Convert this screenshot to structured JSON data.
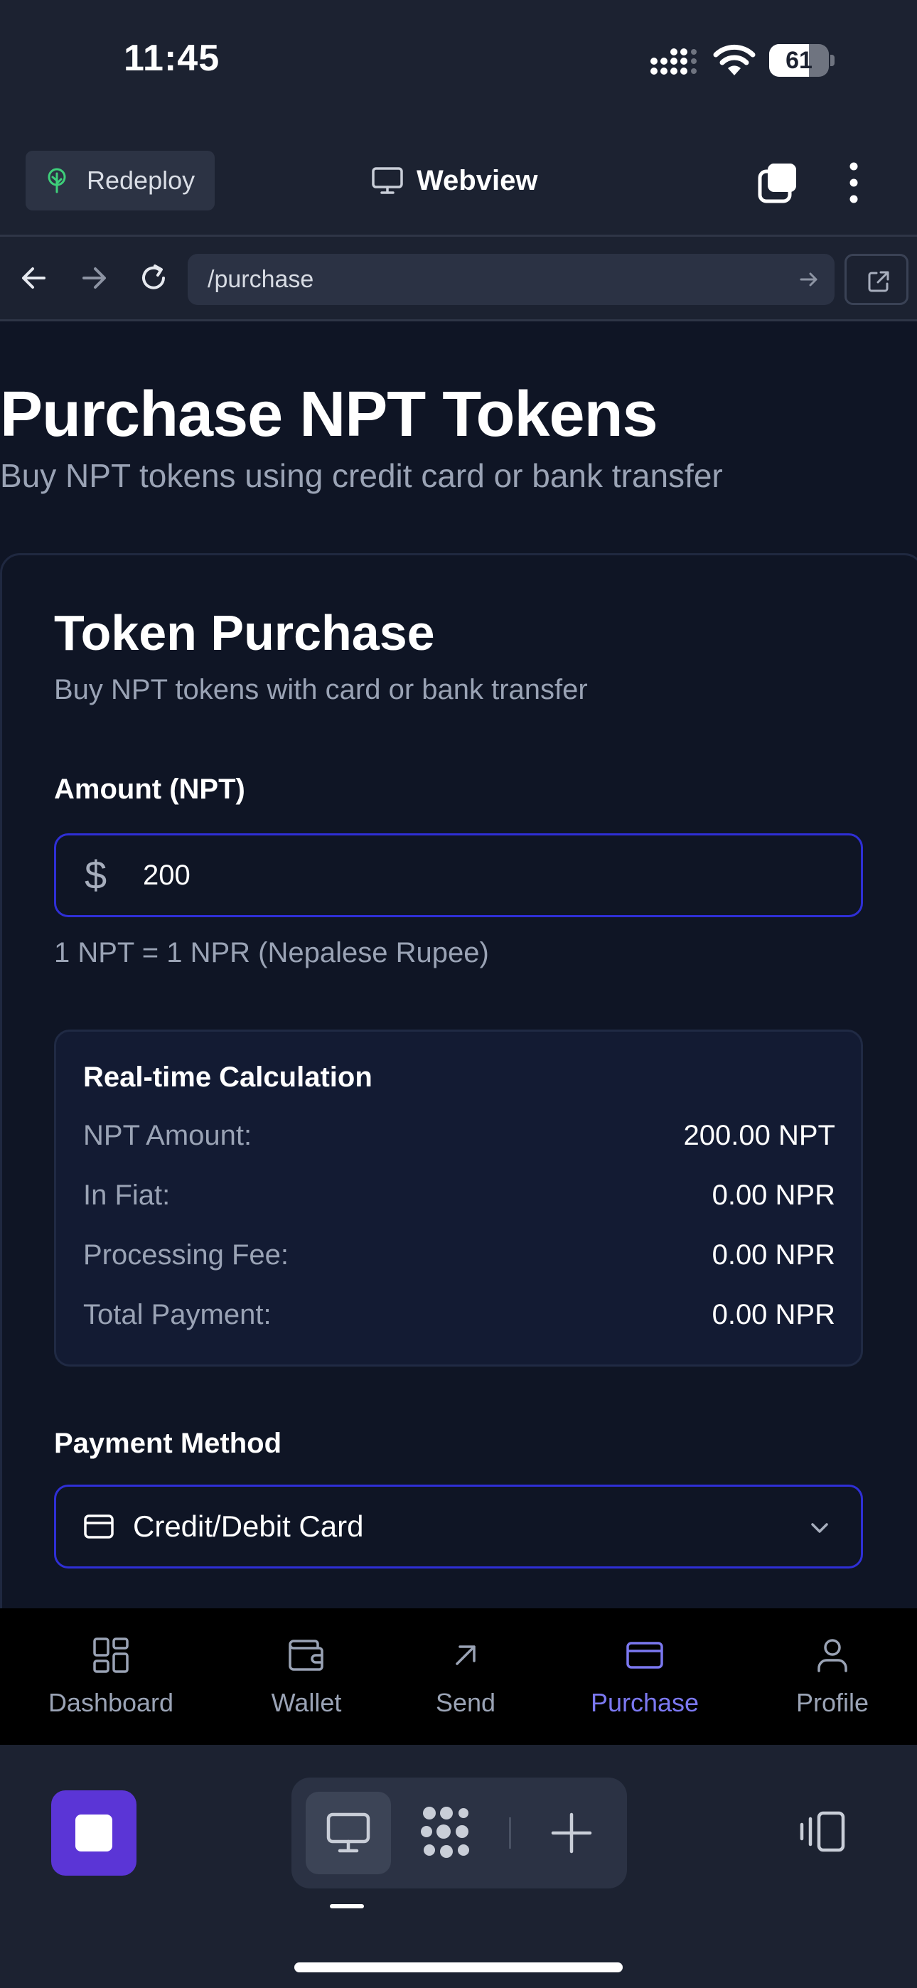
{
  "status_bar": {
    "time": "11:45",
    "battery_level": "61"
  },
  "webview_toolbar": {
    "redeploy_label": "Redeploy",
    "title": "Webview"
  },
  "url_bar": {
    "url": "/purchase"
  },
  "page": {
    "title": "Purchase NPT Tokens",
    "subtitle": "Buy NPT tokens using credit card or bank transfer",
    "card": {
      "title": "Token Purchase",
      "subtitle": "Buy NPT tokens with card or bank transfer",
      "amount_label": "Amount (NPT)",
      "amount_prefix": "$",
      "amount_value": "200",
      "rate_note": "1 NPT = 1 NPR (Nepalese Rupee)",
      "calculation": {
        "title": "Real-time Calculation",
        "rows": [
          {
            "label": "NPT Amount:",
            "value": "200.00 NPT"
          },
          {
            "label": "In Fiat:",
            "value": "0.00 NPR"
          },
          {
            "label": "Processing Fee:",
            "value": "0.00 NPR"
          },
          {
            "label": "Total Payment:",
            "value": "0.00 NPR"
          }
        ]
      },
      "payment_method_label": "Payment Method",
      "payment_method_value": "Credit/Debit Card"
    }
  },
  "app_nav": {
    "active": "Purchase",
    "active_color": "#7b78f0",
    "items": [
      {
        "label": "Dashboard",
        "icon": "dashboard-icon"
      },
      {
        "label": "Wallet",
        "icon": "wallet-icon"
      },
      {
        "label": "Send",
        "icon": "send-arrow-icon"
      },
      {
        "label": "Purchase",
        "icon": "credit-card-icon"
      },
      {
        "label": "Profile",
        "icon": "user-icon"
      }
    ]
  },
  "colors": {
    "accent": "#5b35d6",
    "input_border": "#2f2fd6",
    "page_bg": "#0f1525",
    "chrome_bg": "#1c2231"
  }
}
